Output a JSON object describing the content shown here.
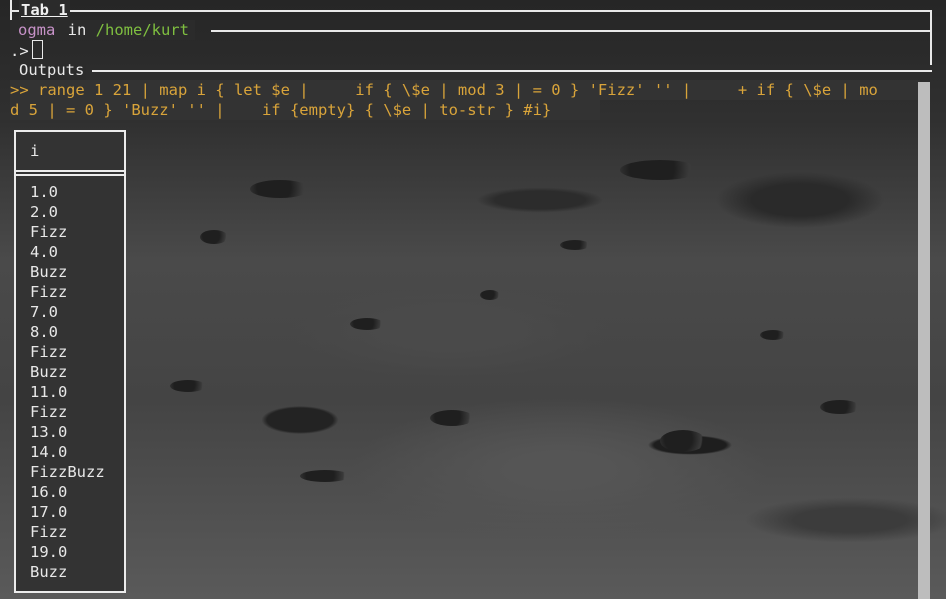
{
  "tab": {
    "title": "Tab 1"
  },
  "prompt": {
    "app_name": "ogma",
    "in_word": " in ",
    "path": "/home/kurt",
    "command_prefix": ".>",
    "input_value": ""
  },
  "outputs": {
    "label": "Outputs",
    "command_line1": ">> range 1 21 | map i { let $e |     if { \\$e | mod 3 | = 0 } 'Fizz' '' |     + if { \\$e | mo",
    "command_line2": "d 5 | = 0 } 'Buzz' '' |    if {empty} { \\$e | to-str } #i}"
  },
  "table": {
    "header": "i",
    "rows": [
      "1.0",
      "2.0",
      "Fizz",
      "4.0",
      "Buzz",
      "Fizz",
      "7.0",
      "8.0",
      "Fizz",
      "Buzz",
      "11.0",
      "Fizz",
      "13.0",
      "14.0",
      "FizzBuzz",
      "16.0",
      "17.0",
      "Fizz",
      "19.0",
      "Buzz"
    ]
  },
  "colors": {
    "app_name": "#c792c8",
    "path": "#7fbf40",
    "command": "#d9a43a",
    "border": "#ececec"
  }
}
